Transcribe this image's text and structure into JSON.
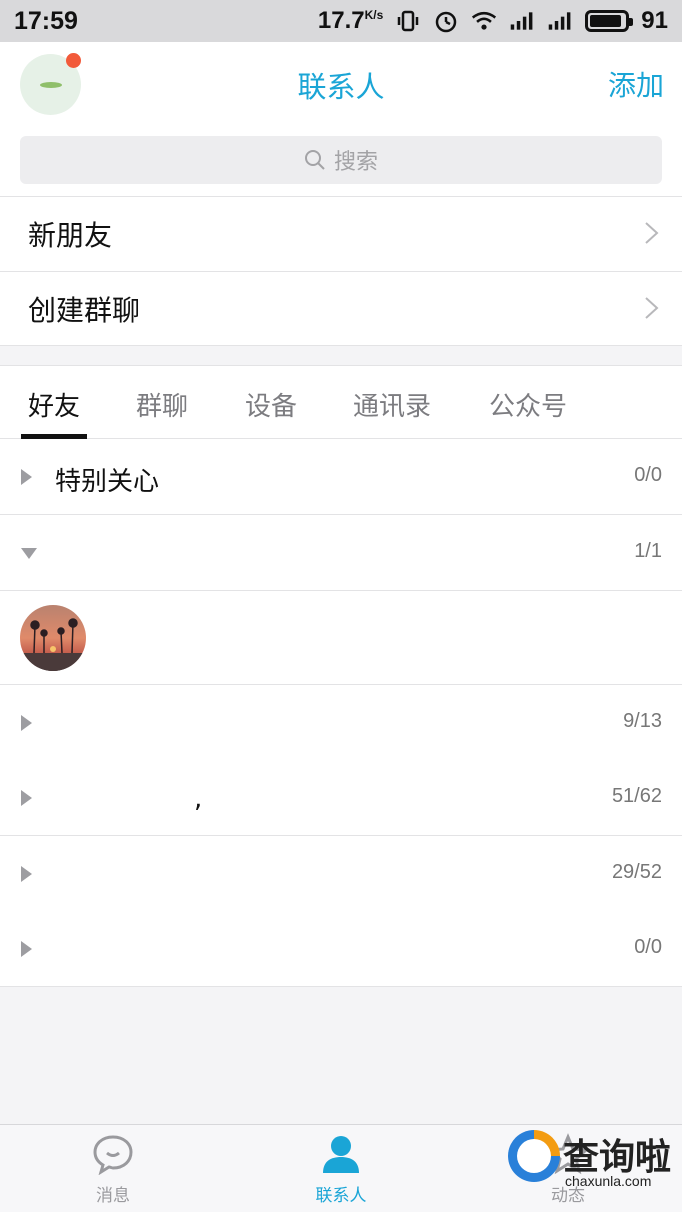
{
  "status_bar": {
    "time": "17:59",
    "speed": "17.7",
    "speed_unit": "K/s",
    "battery": "91"
  },
  "header": {
    "title": "联系人",
    "add_label": "添加"
  },
  "search": {
    "placeholder": "搜索"
  },
  "menu": {
    "new_friends": "新朋友",
    "create_group_chat": "创建群聊"
  },
  "tabs": [
    "好友",
    "群聊",
    "设备",
    "通讯录",
    "公众号"
  ],
  "groups": [
    {
      "name": "特别关心",
      "count": "0/0",
      "expanded": false
    },
    {
      "name": "",
      "count": "1/1",
      "expanded": true
    },
    {
      "name": "",
      "count": "9/13",
      "expanded": false
    },
    {
      "name": ",",
      "count": "51/62",
      "expanded": false
    },
    {
      "name": "",
      "count": "29/52",
      "expanded": false
    },
    {
      "name": "",
      "count": "0/0",
      "expanded": false
    }
  ],
  "bottom_nav": {
    "messages": "消息",
    "contacts": "联系人",
    "dynamics": "动态"
  },
  "watermark": {
    "text": "查询啦",
    "sub": "chaxunla.com"
  },
  "colors": {
    "accent": "#1aa5d6",
    "notification_dot": "#f25a3a"
  }
}
